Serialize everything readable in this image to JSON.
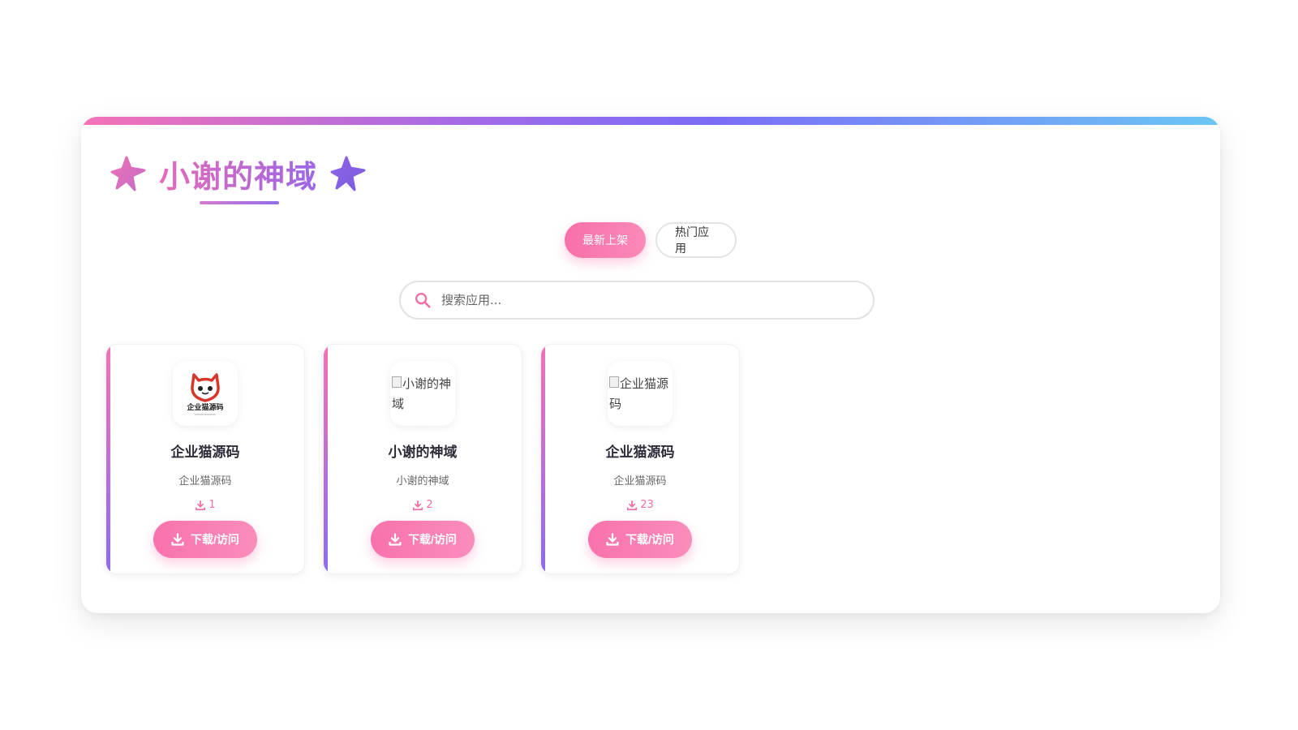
{
  "header": {
    "title": "小谢的神域",
    "left_icon": "sparkle-icon",
    "right_icon": "sparkle-icon"
  },
  "tabs": [
    {
      "label": "最新上架",
      "active": true
    },
    {
      "label": "热门应用",
      "active": false
    }
  ],
  "search": {
    "placeholder": "搜索应用...",
    "value": "",
    "icon": "search-icon"
  },
  "apps": [
    {
      "name": "企业猫源码",
      "description": "企业猫源码",
      "downloads": "1",
      "icon_logo_text": "企业猫源码",
      "icon_alt": "",
      "icon_loaded": true,
      "button_label": "下载/访问"
    },
    {
      "name": "小谢的神域",
      "description": "小谢的神域",
      "downloads": "2",
      "icon_alt": "小谢的神域",
      "icon_loaded": false,
      "button_label": "下载/访问"
    },
    {
      "name": "企业猫源码",
      "description": "企业猫源码",
      "downloads": "23",
      "icon_alt": "企业猫源码",
      "icon_loaded": false,
      "button_label": "下载/访问"
    }
  ],
  "colors": {
    "accent_pink": "#f86fa8",
    "accent_purple": "#8b6cf0",
    "accent_blue": "#6bc7f5"
  }
}
